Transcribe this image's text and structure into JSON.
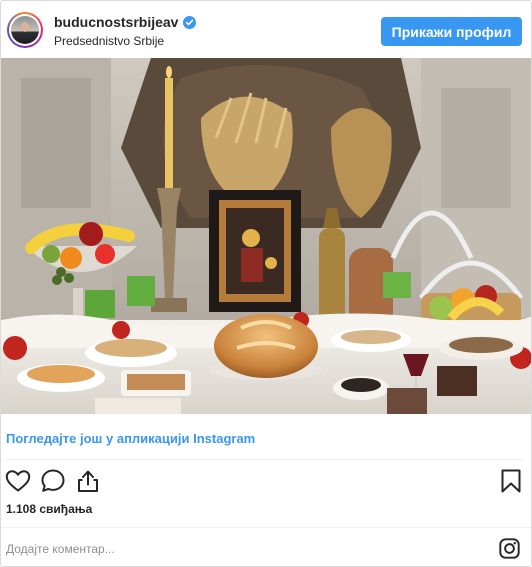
{
  "header": {
    "username": "buducnostsrbijeav",
    "subtitle": "Predsednistvo Srbije",
    "verified": true,
    "profile_button_label": "Прикажи профил"
  },
  "post": {
    "view_more_link": "Погледајте још у апликацији Instagram",
    "likes_text": "1.108 свиђања",
    "comment_placeholder": "Додајте коментар..."
  },
  "icons": {
    "like": "heart-outline-icon",
    "comment": "speech-bubble-icon",
    "share": "share-upload-icon",
    "save": "bookmark-icon",
    "app": "instagram-logo-icon"
  },
  "colors": {
    "accent": "#3897f0",
    "text": "#262626",
    "muted": "#8e8e8e",
    "border": "#dbdbdb"
  }
}
